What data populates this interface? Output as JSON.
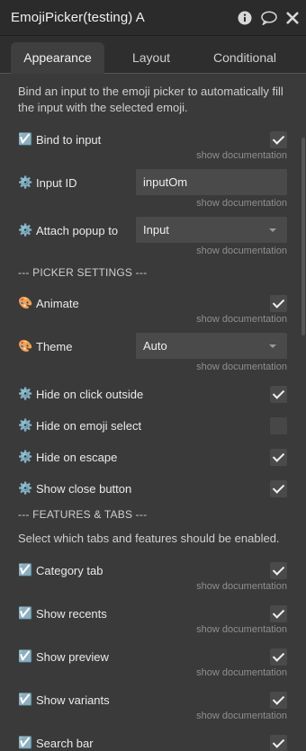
{
  "window": {
    "title": "EmojiPicker(testing) A",
    "icons": [
      "info-icon",
      "comment-icon",
      "close-icon"
    ]
  },
  "tabs": [
    {
      "label": "Appearance",
      "active": true
    },
    {
      "label": "Layout",
      "active": false
    },
    {
      "label": "Conditional",
      "active": false
    }
  ],
  "description": "Bind an input to the emoji picker to automatically fill the input with the selected emoji.",
  "show_doc": "show documentation",
  "fields": {
    "bind_to_input": {
      "icon": "☑️",
      "label": "Bind to input",
      "checked": true
    },
    "input_id": {
      "icon": "⚙️",
      "label": "Input ID",
      "value": "inputOm"
    },
    "attach_popup": {
      "icon": "⚙️",
      "label": "Attach popup to",
      "value": "Input"
    },
    "picker_settings": "--- PICKER SETTINGS ---",
    "animate": {
      "icon": "🎨",
      "label": "Animate",
      "checked": true
    },
    "theme": {
      "icon": "🎨",
      "label": "Theme",
      "value": "Auto"
    },
    "hide_click_outside": {
      "icon": "⚙️",
      "label": "Hide on click outside",
      "checked": true
    },
    "hide_emoji_select": {
      "icon": "⚙️",
      "label": "Hide on emoji select",
      "checked": false
    },
    "hide_escape": {
      "icon": "⚙️",
      "label": "Hide on escape",
      "checked": true
    },
    "show_close": {
      "icon": "⚙️",
      "label": "Show close button",
      "checked": true
    },
    "features_tabs": "--- FEATURES & TABS ---",
    "features_desc": "Select which tabs and features should be enabled.",
    "category_tab": {
      "icon": "☑️",
      "label": "Category tab",
      "checked": true
    },
    "show_recents": {
      "icon": "☑️",
      "label": "Show recents",
      "checked": true
    },
    "show_preview": {
      "icon": "☑️",
      "label": "Show preview",
      "checked": true
    },
    "show_variants": {
      "icon": "☑️",
      "label": "Show variants",
      "checked": true
    },
    "search_bar": {
      "icon": "☑️",
      "label": "Search bar",
      "checked": true
    }
  },
  "colors": {
    "background": "#3a3a3a",
    "titlebar": "#2b2b2b",
    "control": "#4a4a4a",
    "muted_text": "#8f8f8f"
  }
}
